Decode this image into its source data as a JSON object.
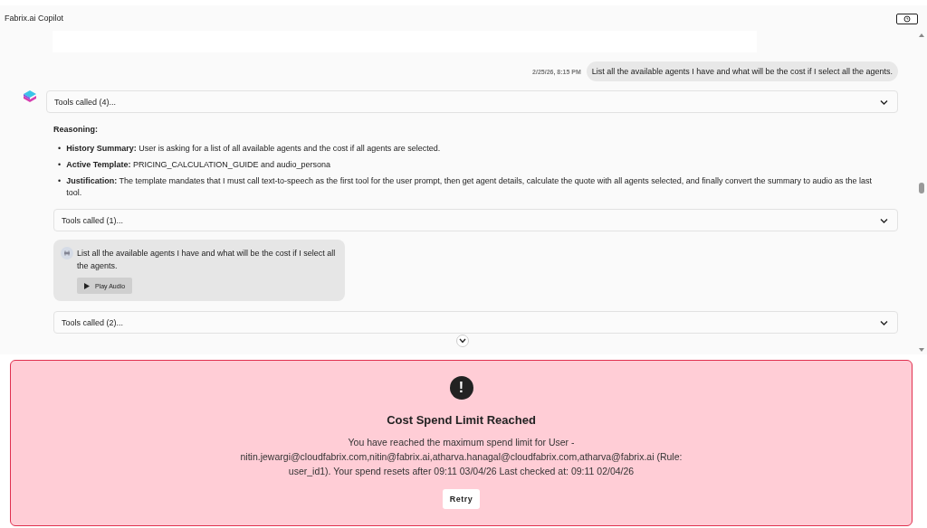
{
  "window": {
    "title": "Fabrix.ai Copilot"
  },
  "user_message": {
    "time": "2/25/26, 8:15 PM",
    "text": "List all the available agents I have and what will be the cost if I select all the agents."
  },
  "tool_panels_top": [
    {
      "label": "Tools called (4)...",
      "expanded": false
    }
  ],
  "reasoning": {
    "heading": "Reasoning:",
    "items": [
      {
        "marker": "•",
        "text": "**History Summary:** User is asking for a list of all available agents and the cost if all agents are selected."
      },
      {
        "marker": "•",
        "text": "**Active Template:** PRICING_CALCULATION_GUIDE and audio_persona"
      },
      {
        "marker": "•",
        "text": "**Justification:** The template mandates that I must call text-to-speech as the first tool for the user prompt, then get agent details, calculate the quote with all agents selected, and finally convert the summary to audio as the last tool."
      }
    ]
  },
  "tool_panel_mid": {
    "label": "Tools called (1)...",
    "expanded": false
  },
  "audio_message": {
    "text": "List all the available agents I have and what will be the cost if I select all the agents.",
    "button": "Play Audio"
  },
  "tool_panel_bottom": {
    "label": "Tools called (2)...",
    "expanded": false
  },
  "error": {
    "icon": "!",
    "title": "Cost Spend Limit Reached",
    "message": "You have reached the maximum spend limit for User - nitin.jewargi@cloudfabrix.com,nitin@fabrix.ai,atharva.hanagal@cloudfabrix.com,atharva@fabrix.ai (Rule: user_id1). Your spend resets after 09:11 03/04/26 Last checked at: 09:11 02/04/26",
    "button": "Retry"
  }
}
